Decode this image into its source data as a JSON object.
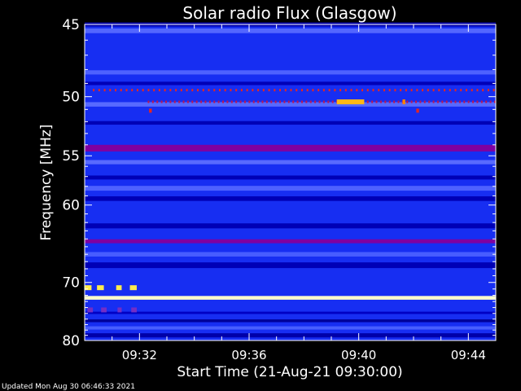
{
  "chart_data": {
    "type": "heatmap",
    "title": "Solar radio Flux (Glasgow)",
    "xlabel": "Start Time (21-Aug-21 09:30:00)",
    "ylabel": "Frequency [MHz]",
    "footer": "Updated Mon Aug 30 06:46:33 2021",
    "x_ticks": [
      "09:32",
      "09:36",
      "09:40",
      "09:44"
    ],
    "x_tick_minutes": [
      2,
      6,
      10,
      14
    ],
    "x_range_minutes": [
      0,
      15
    ],
    "y_ticks": [
      45,
      50,
      55,
      60,
      70,
      80
    ],
    "y_range": [
      45,
      80
    ],
    "y_scale": "reciprocal",
    "colorscale": [
      "#00006e",
      "#0000c8",
      "#1e3cff",
      "#6070ff",
      "#8000a0",
      "#ff3000",
      "#ffa000",
      "#ffff60",
      "#ffffff"
    ],
    "background_level": 0.22,
    "bands": [
      {
        "freq": 45.0,
        "width": 0.25,
        "level": 0.08
      },
      {
        "freq": 45.4,
        "width": 0.3,
        "level": 0.35
      },
      {
        "freq": 48.2,
        "width": 0.3,
        "level": 0.34
      },
      {
        "freq": 49.0,
        "width": 0.25,
        "level": 0.1
      },
      {
        "freq": 50.6,
        "width": 0.35,
        "level": 0.36
      },
      {
        "freq": 52.1,
        "width": 0.3,
        "level": 0.1
      },
      {
        "freq": 54.3,
        "width": 0.6,
        "level": 0.5
      },
      {
        "freq": 55.6,
        "width": 0.4,
        "level": 0.36
      },
      {
        "freq": 57.1,
        "width": 0.4,
        "level": 0.1
      },
      {
        "freq": 58.2,
        "width": 0.5,
        "level": 0.34
      },
      {
        "freq": 59.3,
        "width": 0.5,
        "level": 0.1
      },
      {
        "freq": 62.4,
        "width": 0.6,
        "level": 0.1
      },
      {
        "freq": 64.3,
        "width": 0.5,
        "level": 0.5
      },
      {
        "freq": 66.0,
        "width": 0.6,
        "level": 0.33
      },
      {
        "freq": 67.5,
        "width": 0.8,
        "level": 0.1
      },
      {
        "freq": 72.4,
        "width": 0.6,
        "level": 0.96
      },
      {
        "freq": 74.9,
        "width": 0.4,
        "level": 0.12
      },
      {
        "freq": 76.3,
        "width": 0.5,
        "level": 0.06
      },
      {
        "freq": 77.6,
        "width": 0.6,
        "level": 0.33
      },
      {
        "freq": 79.0,
        "width": 0.8,
        "level": 0.08
      }
    ],
    "interference_rows": [
      {
        "freq": 49.5,
        "period_minutes": 0.2,
        "level": 0.6,
        "start_minutes": 0.3,
        "end_minutes": 15
      },
      {
        "freq": 50.4,
        "period_minutes": 0.16,
        "level": 0.56,
        "start_minutes": 2.3,
        "end_minutes": 15
      },
      {
        "freq": 51.1,
        "period_minutes": 0,
        "level": 0.6,
        "start_minutes": 2.35,
        "end_minutes": 2.45
      },
      {
        "freq": 51.1,
        "period_minutes": 0,
        "level": 0.6,
        "start_minutes": 12.1,
        "end_minutes": 12.2
      }
    ],
    "bursts": [
      {
        "freq": 70.8,
        "start_minutes": 0.0,
        "end_minutes": 0.25,
        "level": 0.85
      },
      {
        "freq": 70.8,
        "start_minutes": 0.45,
        "end_minutes": 0.7,
        "level": 0.85
      },
      {
        "freq": 70.8,
        "start_minutes": 1.15,
        "end_minutes": 1.35,
        "level": 0.85
      },
      {
        "freq": 70.8,
        "start_minutes": 1.65,
        "end_minutes": 1.9,
        "level": 0.85
      },
      {
        "freq": 50.4,
        "start_minutes": 9.2,
        "end_minutes": 10.2,
        "level": 0.78
      },
      {
        "freq": 50.4,
        "start_minutes": 11.6,
        "end_minutes": 11.7,
        "level": 0.72
      },
      {
        "freq": 74.4,
        "start_minutes": 0.1,
        "end_minutes": 0.3,
        "level": 0.45
      },
      {
        "freq": 74.4,
        "start_minutes": 0.6,
        "end_minutes": 0.8,
        "level": 0.45
      },
      {
        "freq": 74.4,
        "start_minutes": 1.2,
        "end_minutes": 1.35,
        "level": 0.45
      },
      {
        "freq": 74.4,
        "start_minutes": 1.7,
        "end_minutes": 1.9,
        "level": 0.45
      }
    ]
  }
}
